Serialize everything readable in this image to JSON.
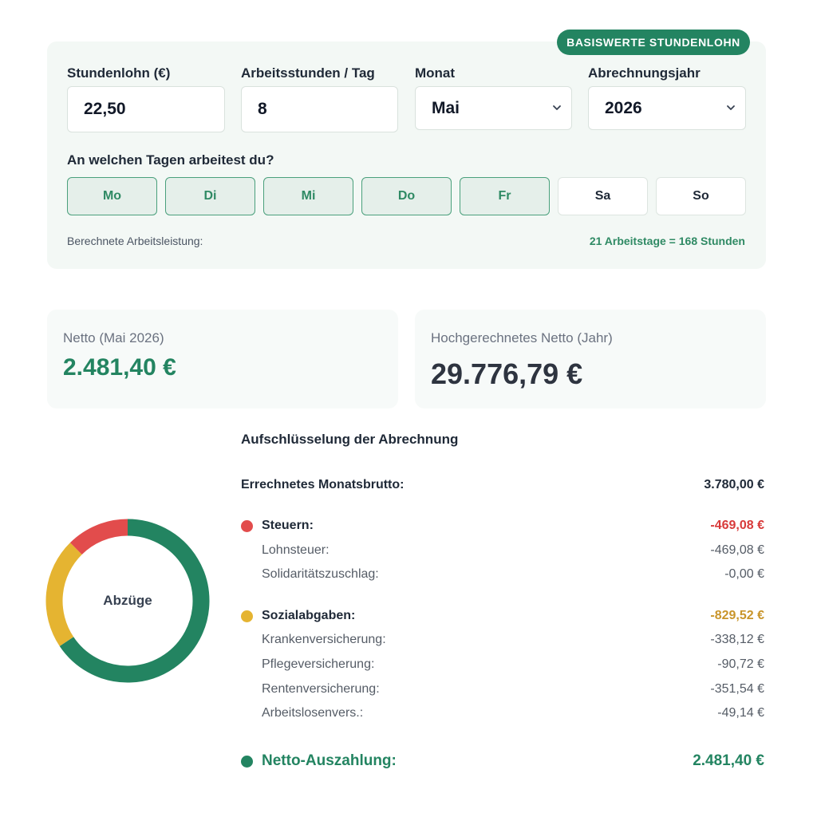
{
  "colors": {
    "accent": "#238461",
    "taxes": "#e24c4c",
    "social": "#e5b431",
    "net": "#238461",
    "panel_bg": "#f3f8f5"
  },
  "header": {
    "badge": "BASISWERTE STUNDENLOHN"
  },
  "fields": {
    "wage_label": "Stundenlohn (€)",
    "wage_value": "22,50",
    "hours_label": "Arbeitsstunden / Tag",
    "hours_value": "8",
    "month_label": "Monat",
    "month_value": "Mai",
    "year_label": "Abrechnungsjahr",
    "year_value": "2026"
  },
  "days": {
    "title": "An welchen Tagen arbeitest du?",
    "items": [
      {
        "label": "Mo",
        "active": true
      },
      {
        "label": "Di",
        "active": true
      },
      {
        "label": "Mi",
        "active": true
      },
      {
        "label": "Do",
        "active": true
      },
      {
        "label": "Fr",
        "active": true
      },
      {
        "label": "Sa",
        "active": false
      },
      {
        "label": "So",
        "active": false
      }
    ]
  },
  "calc": {
    "label": "Berechnete Arbeitsleistung:",
    "value": "21 Arbeitstage = 168 Stunden"
  },
  "cards": {
    "net_month_label": "Netto (Mai 2026)",
    "net_month_value": "2.481,40 €",
    "net_year_label": "Hochgerechnetes Netto (Jahr)",
    "net_year_value": "29.776,79 €"
  },
  "donut": {
    "center_label": "Abzüge",
    "segments": [
      {
        "name": "Steuern",
        "value": 469.08,
        "color": "#e24c4c"
      },
      {
        "name": "Sozialabgaben",
        "value": 829.52,
        "color": "#e5b431"
      },
      {
        "name": "Netto-Auszahlung",
        "value": 2481.4,
        "color": "#238461"
      }
    ]
  },
  "breakdown": {
    "title": "Aufschlüsselung der Abrechnung",
    "gross_label": "Errechnetes Monatsbrutto:",
    "gross_value": "3.780,00 €",
    "taxes": {
      "label": "Steuern:",
      "value": "-469,08 €",
      "items": [
        {
          "label": "Lohnsteuer:",
          "value": "-469,08 €"
        },
        {
          "label": "Solidaritätszuschlag:",
          "value": "-0,00 €"
        }
      ]
    },
    "social": {
      "label": "Sozialabgaben:",
      "value": "-829,52 €",
      "items": [
        {
          "label": "Krankenversicherung:",
          "value": "-338,12 €"
        },
        {
          "label": "Pflegeversicherung:",
          "value": "-90,72 €"
        },
        {
          "label": "Rentenversicherung:",
          "value": "-351,54 €"
        },
        {
          "label": "Arbeitslosenvers.:",
          "value": "-49,14 €"
        }
      ]
    },
    "net_label": "Netto-Auszahlung:",
    "net_value": "2.481,40 €"
  }
}
